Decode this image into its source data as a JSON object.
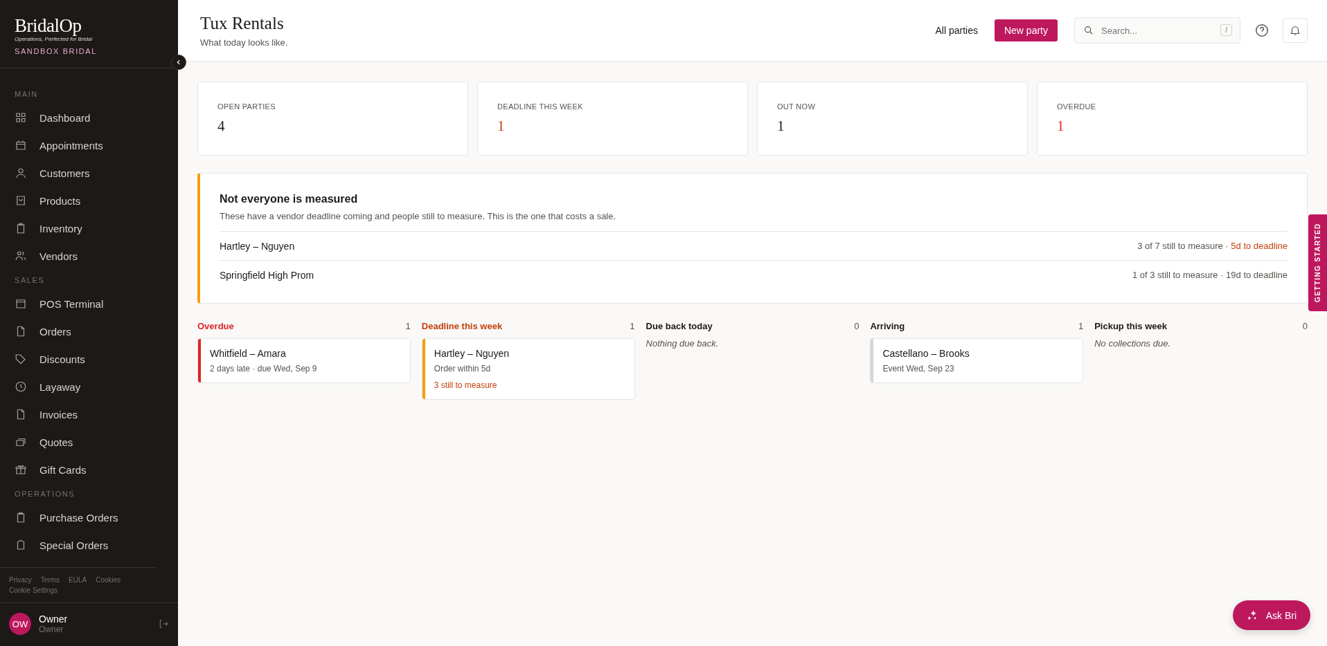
{
  "brand": {
    "name": "BridalOp",
    "tagline": "Operations, Perfected for Bridal",
    "store": "SANDBOX BRIDAL"
  },
  "nav": [
    {
      "label": "MAIN",
      "items": [
        {
          "label": "Dashboard",
          "selected": false
        },
        {
          "label": "Appointments",
          "selected": false
        },
        {
          "label": "Customers",
          "selected": false
        },
        {
          "label": "Products",
          "selected": false
        },
        {
          "label": "Inventory",
          "selected": false
        },
        {
          "label": "Vendors",
          "selected": false
        }
      ]
    },
    {
      "label": "SALES",
      "items": [
        {
          "label": "POS Terminal",
          "selected": false
        },
        {
          "label": "Orders",
          "selected": false
        },
        {
          "label": "Discounts",
          "selected": false
        },
        {
          "label": "Layaway",
          "selected": false
        },
        {
          "label": "Invoices",
          "selected": false
        },
        {
          "label": "Quotes",
          "selected": false
        },
        {
          "label": "Gift Cards",
          "selected": false
        }
      ]
    },
    {
      "label": "OPERATIONS",
      "items": [
        {
          "label": "Purchase Orders",
          "selected": false
        },
        {
          "label": "Special Orders",
          "selected": false
        }
      ]
    }
  ],
  "footer_links": [
    "Privacy",
    "Terms",
    "EULA",
    "Cookies",
    "Cookie Settings"
  ],
  "user": {
    "initials": "OW",
    "name": "Owner",
    "role": "Owner"
  },
  "header": {
    "title": "Tux Rentals",
    "subtitle": "What today looks like.",
    "link": "All parties",
    "primary": "New party",
    "search": {
      "placeholder": "Search...",
      "shortcut": "/"
    }
  },
  "stats": [
    {
      "label": "OPEN PARTIES",
      "value": "4",
      "color": "#1c1917"
    },
    {
      "label": "DEADLINE THIS WEEK",
      "value": "1",
      "color": "#c2410c"
    },
    {
      "label": "OUT NOW",
      "value": "1",
      "color": "#1c1917"
    },
    {
      "label": "OVERDUE",
      "value": "1",
      "color": "#dc2626"
    }
  ],
  "alert": {
    "title": "Not everyone is measured",
    "description": "These have a vendor deadline coming and people still to measure. This is the one that costs a sale.",
    "rows": [
      {
        "name": "Hartley – Nguyen",
        "progress": "3 of 7 still to measure ·",
        "deadline": "5d to deadline",
        "urgent": true
      },
      {
        "name": "Springfield High Prom",
        "progress": "1 of 3 still to measure ·",
        "deadline": "19d to deadline",
        "urgent": false
      }
    ]
  },
  "columns": [
    {
      "title": "Overdue",
      "count": "1",
      "color": "#dc2626",
      "cards": [
        {
          "title": "Whitfield – Amara",
          "color": "#dc2626",
          "lines": [
            {
              "text": "2 days late · due Wed, Sep 9",
              "urgent": false
            }
          ]
        }
      ]
    },
    {
      "title": "Deadline this week",
      "count": "1",
      "color": "#c2410c",
      "cards": [
        {
          "title": "Hartley – Nguyen",
          "color": "#f59e0b",
          "lines": [
            {
              "text": "Order within 5d",
              "urgent": false
            },
            {
              "text": "3 still to measure",
              "urgent": true
            }
          ]
        }
      ]
    },
    {
      "title": "Due back today",
      "count": "0",
      "color": "#1c1917",
      "empty": "Nothing due back."
    },
    {
      "title": "Arriving",
      "count": "1",
      "color": "#1c1917",
      "cards": [
        {
          "title": "Castellano – Brooks",
          "color": "#d6d3d1",
          "lines": [
            {
              "text": "Event Wed, Sep 23",
              "urgent": false
            }
          ]
        }
      ]
    },
    {
      "title": "Pickup this week",
      "count": "0",
      "color": "#1c1917",
      "empty": "No collections due."
    }
  ],
  "side_tab": "GETTING STARTED",
  "assistant": "Ask Bri"
}
